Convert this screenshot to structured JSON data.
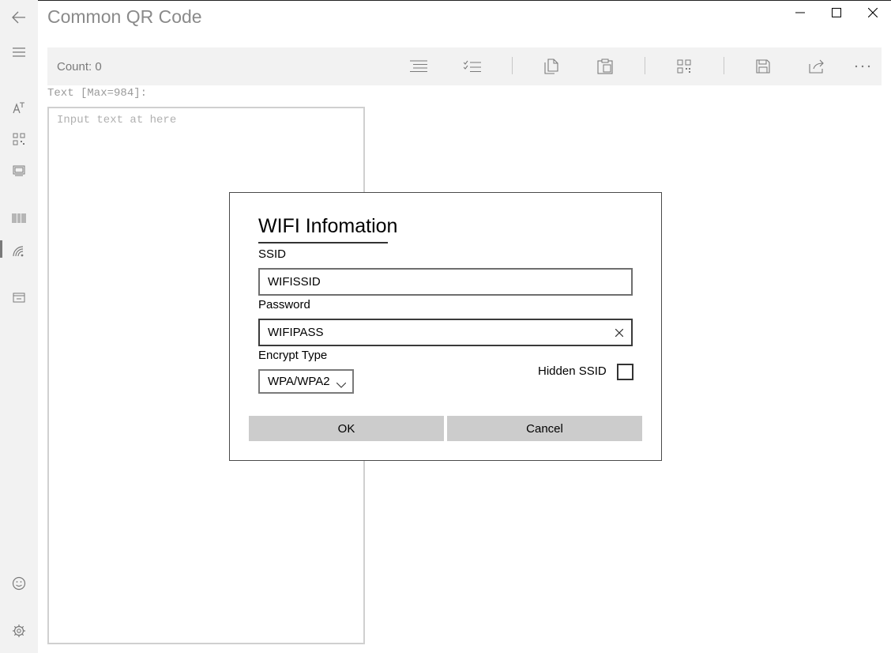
{
  "app": {
    "title": "Common QR Code"
  },
  "nav": {
    "items": [
      {
        "icon": "back-arrow-icon"
      },
      {
        "icon": "hamburger-menu-icon"
      },
      {
        "icon": "text-font-icon"
      },
      {
        "icon": "qr-code-icon"
      },
      {
        "icon": "image-frame-icon"
      },
      {
        "icon": "barcode-icon"
      },
      {
        "icon": "wifi-icon",
        "active": true
      },
      {
        "icon": "contact-card-icon"
      },
      {
        "icon": "smiley-icon"
      },
      {
        "icon": "gear-icon"
      }
    ]
  },
  "window_controls": [
    "minimize-icon",
    "maximize-icon",
    "close-icon"
  ],
  "command_bar": {
    "count_label": "Count: 0",
    "buttons": [
      "list-icon",
      "checklist-icon",
      "copy-icon",
      "paste-icon",
      "qr-generate-icon",
      "save-icon",
      "share-icon",
      "more-icon"
    ]
  },
  "editor": {
    "label": "Text [Max=984]:",
    "placeholder": "Input text at here",
    "value": ""
  },
  "dialog": {
    "title": "WIFI Infomation",
    "ssid_label": "SSID",
    "ssid_value": "WIFISSID",
    "password_label": "Password",
    "password_value": "WIFIPASS",
    "encrypt_label": "Encrypt Type",
    "encrypt_value": "WPA/WPA2",
    "hidden_ssid_label": "Hidden SSID",
    "hidden_ssid_checked": false,
    "ok_label": "OK",
    "cancel_label": "Cancel"
  },
  "colors": {
    "nav_bg": "#f2f2f2",
    "command_bar_bg": "#f2f2f2",
    "button_bg": "#cccccc",
    "title_text": "#8a8a8a"
  }
}
